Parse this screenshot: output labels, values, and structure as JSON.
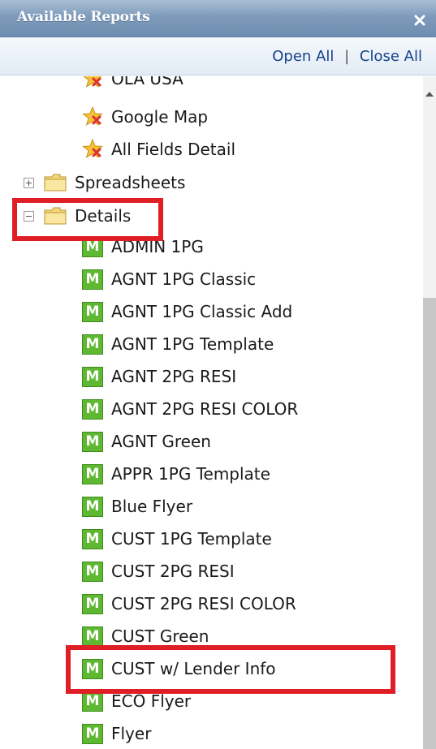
{
  "panel": {
    "title": "Available Reports",
    "close_glyph": "×",
    "toolbar": {
      "open_all": "Open All",
      "separator": "|",
      "close_all": "Close All"
    }
  },
  "tree": {
    "favorites": [
      {
        "label": "OLA USA",
        "icon": "star-remove-icon"
      },
      {
        "label": "Google Map",
        "icon": "star-remove-icon"
      },
      {
        "label": "All Fields Detail",
        "icon": "star-remove-icon"
      }
    ],
    "folders": [
      {
        "label": "Spreadsheets",
        "expanded": false,
        "icon": "folder-icon"
      },
      {
        "label": "Details",
        "expanded": true,
        "icon": "folder-icon"
      }
    ],
    "details_items": [
      {
        "label": "ADMIN 1PG",
        "badge": "M"
      },
      {
        "label": "AGNT 1PG Classic",
        "badge": "M"
      },
      {
        "label": "AGNT 1PG Classic Add",
        "badge": "M"
      },
      {
        "label": "AGNT 1PG Template",
        "badge": "M"
      },
      {
        "label": "AGNT 2PG RESI",
        "badge": "M"
      },
      {
        "label": "AGNT 2PG RESI COLOR",
        "badge": "M"
      },
      {
        "label": "AGNT Green",
        "badge": "M"
      },
      {
        "label": "APPR 1PG Template",
        "badge": "M"
      },
      {
        "label": "Blue Flyer",
        "badge": "M"
      },
      {
        "label": "CUST 1PG Template",
        "badge": "M"
      },
      {
        "label": "CUST 2PG RESI",
        "badge": "M"
      },
      {
        "label": "CUST 2PG RESI COLOR",
        "badge": "M"
      },
      {
        "label": "CUST Green",
        "badge": "M"
      },
      {
        "label": "CUST w/ Lender Info",
        "badge": "M"
      },
      {
        "label": "ECO Flyer",
        "badge": "M"
      },
      {
        "label": "Flyer",
        "badge": "M"
      }
    ]
  },
  "colors": {
    "title_bar": "#7f9bbb",
    "link": "#15428b",
    "m_badge": "#5fb832",
    "highlight": "#e01e25",
    "folder": "#f3d77a"
  }
}
